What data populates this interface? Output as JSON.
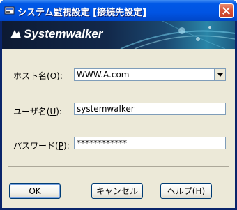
{
  "window": {
    "title": "システム監視設定 [接続先設定]",
    "close_icon": "close-icon"
  },
  "banner": {
    "brand": "Systemwalker"
  },
  "form": {
    "host": {
      "label_prefix": "ホスト名(",
      "mnemonic": "O",
      "label_suffix": "):",
      "value": "WWW.A.com"
    },
    "user": {
      "label_prefix": "ユーザ名(",
      "mnemonic": "U",
      "label_suffix": "):",
      "value": "systemwalker"
    },
    "password": {
      "label_prefix": "パスワード(",
      "mnemonic": "P",
      "label_suffix": "):",
      "value": "************"
    }
  },
  "buttons": {
    "ok": "OK",
    "cancel": "キャンセル",
    "help_prefix": "ヘルプ(",
    "help_mnemonic": "H",
    "help_suffix": ")"
  }
}
